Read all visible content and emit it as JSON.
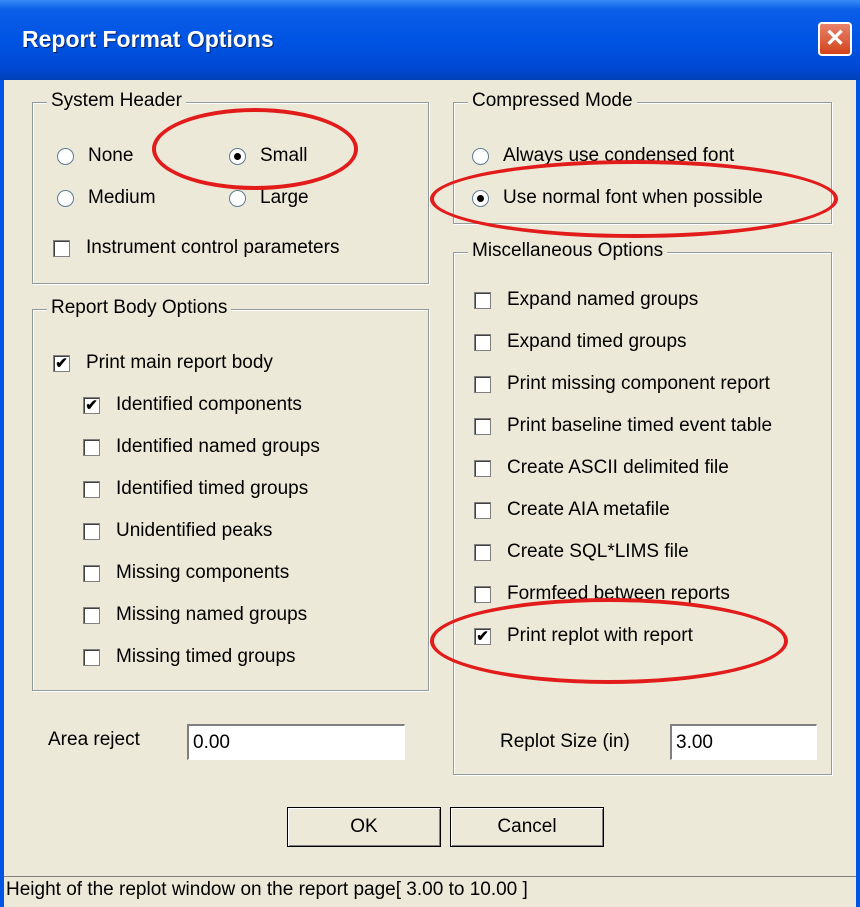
{
  "window": {
    "title": "Report Format Options",
    "close_glyph": "✕"
  },
  "system_header": {
    "legend": "System Header",
    "options": [
      {
        "label": "None",
        "selected": false
      },
      {
        "label": "Small",
        "selected": true
      },
      {
        "label": "Medium",
        "selected": false
      },
      {
        "label": "Large",
        "selected": false
      }
    ],
    "instrument_control": {
      "label": "Instrument control parameters",
      "checked": false
    }
  },
  "report_body": {
    "legend": "Report Body Options",
    "items": [
      {
        "label": "Print main report body",
        "checked": true
      },
      {
        "label": "Identified components",
        "checked": true
      },
      {
        "label": "Identified named groups",
        "checked": false
      },
      {
        "label": "Identified timed groups",
        "checked": false
      },
      {
        "label": "Unidentified peaks",
        "checked": false
      },
      {
        "label": "Missing components",
        "checked": false
      },
      {
        "label": "Missing named groups",
        "checked": false
      },
      {
        "label": "Missing timed groups",
        "checked": false
      }
    ]
  },
  "area_reject": {
    "label": "Area reject",
    "value": "0.00"
  },
  "compressed_mode": {
    "legend": "Compressed Mode",
    "options": [
      {
        "label": "Always use condensed font",
        "selected": false
      },
      {
        "label": "Use normal font when possible",
        "selected": true
      }
    ]
  },
  "misc": {
    "legend": "Miscellaneous Options",
    "items": [
      {
        "label": "Expand named groups",
        "checked": false
      },
      {
        "label": "Expand timed groups",
        "checked": false
      },
      {
        "label": "Print missing component report",
        "checked": false
      },
      {
        "label": "Print baseline timed event table",
        "checked": false
      },
      {
        "label": "Create ASCII delimited file",
        "checked": false
      },
      {
        "label": "Create AIA metafile",
        "checked": false
      },
      {
        "label": "Create SQL*LIMS file",
        "checked": false
      },
      {
        "label": "Formfeed between reports",
        "checked": false
      },
      {
        "label": "Print replot with report",
        "checked": true
      }
    ]
  },
  "replot_size": {
    "label": "Replot Size (in)",
    "value": "3.00"
  },
  "buttons": {
    "ok": "OK",
    "cancel": "Cancel"
  },
  "status": "Height of the replot window on the report page[ 3.00 to 10.00 ]",
  "annotation_color": "#e21b1b",
  "check_glyph": "✔"
}
